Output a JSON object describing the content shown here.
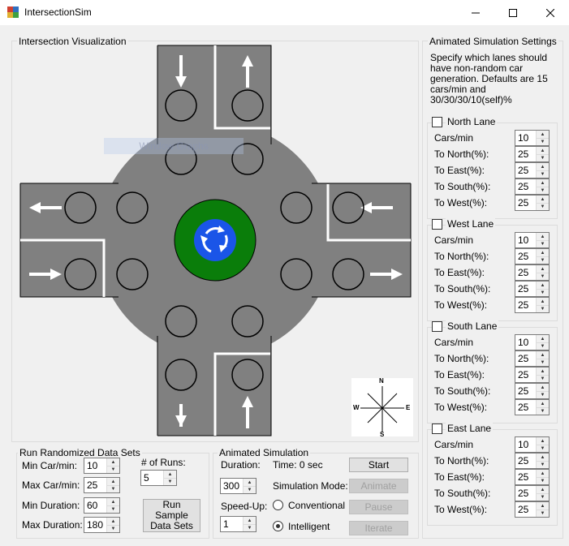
{
  "window": {
    "title": "IntersectionSim"
  },
  "visualization": {
    "group_title": "Intersection Visualization",
    "ghost_text": "Window Graphs"
  },
  "compass": {
    "n": "N",
    "s": "S",
    "e": "E",
    "w": "W"
  },
  "settings": {
    "group_title": "Animated Simulation Settings",
    "description": "Specify which lanes should have non-random car generation. Defaults are  15 cars/min and 30/30/30/10(self)%",
    "field_labels": [
      "Cars/min",
      "To North(%):",
      "To East(%):",
      "To South(%):",
      "To West(%):"
    ],
    "lanes": [
      {
        "name": "North Lane",
        "values": [
          "10",
          "25",
          "25",
          "25",
          "25"
        ]
      },
      {
        "name": "West Lane",
        "values": [
          "10",
          "25",
          "25",
          "25",
          "25"
        ]
      },
      {
        "name": "South Lane",
        "values": [
          "10",
          "25",
          "25",
          "25",
          "25"
        ]
      },
      {
        "name": "East Lane",
        "values": [
          "10",
          "25",
          "25",
          "25",
          "25"
        ]
      }
    ]
  },
  "randomized": {
    "group_title": "Run Randomized Data Sets",
    "min_car_label": "Min Car/min:",
    "min_car": "10",
    "max_car_label": "Max Car/min:",
    "max_car": "25",
    "min_dur_label": "Min Duration:",
    "min_dur": "60",
    "max_dur_label": "Max Duration:",
    "max_dur": "180",
    "runs_label": "# of Runs:",
    "runs": "5",
    "run_button": "Run Sample Data Sets"
  },
  "animated": {
    "group_title": "Animated Simulation",
    "duration_label": "Duration:",
    "duration": "300",
    "time_label": "Time: 0 sec",
    "speedup_label": "Speed-Up:",
    "speedup": "1",
    "mode_label": "Simulation Mode:",
    "mode_conventional": "Conventional",
    "mode_intelligent": "Intelligent",
    "start": "Start",
    "animate": "Animate",
    "pause": "Pause",
    "iterate": "Iterate"
  }
}
